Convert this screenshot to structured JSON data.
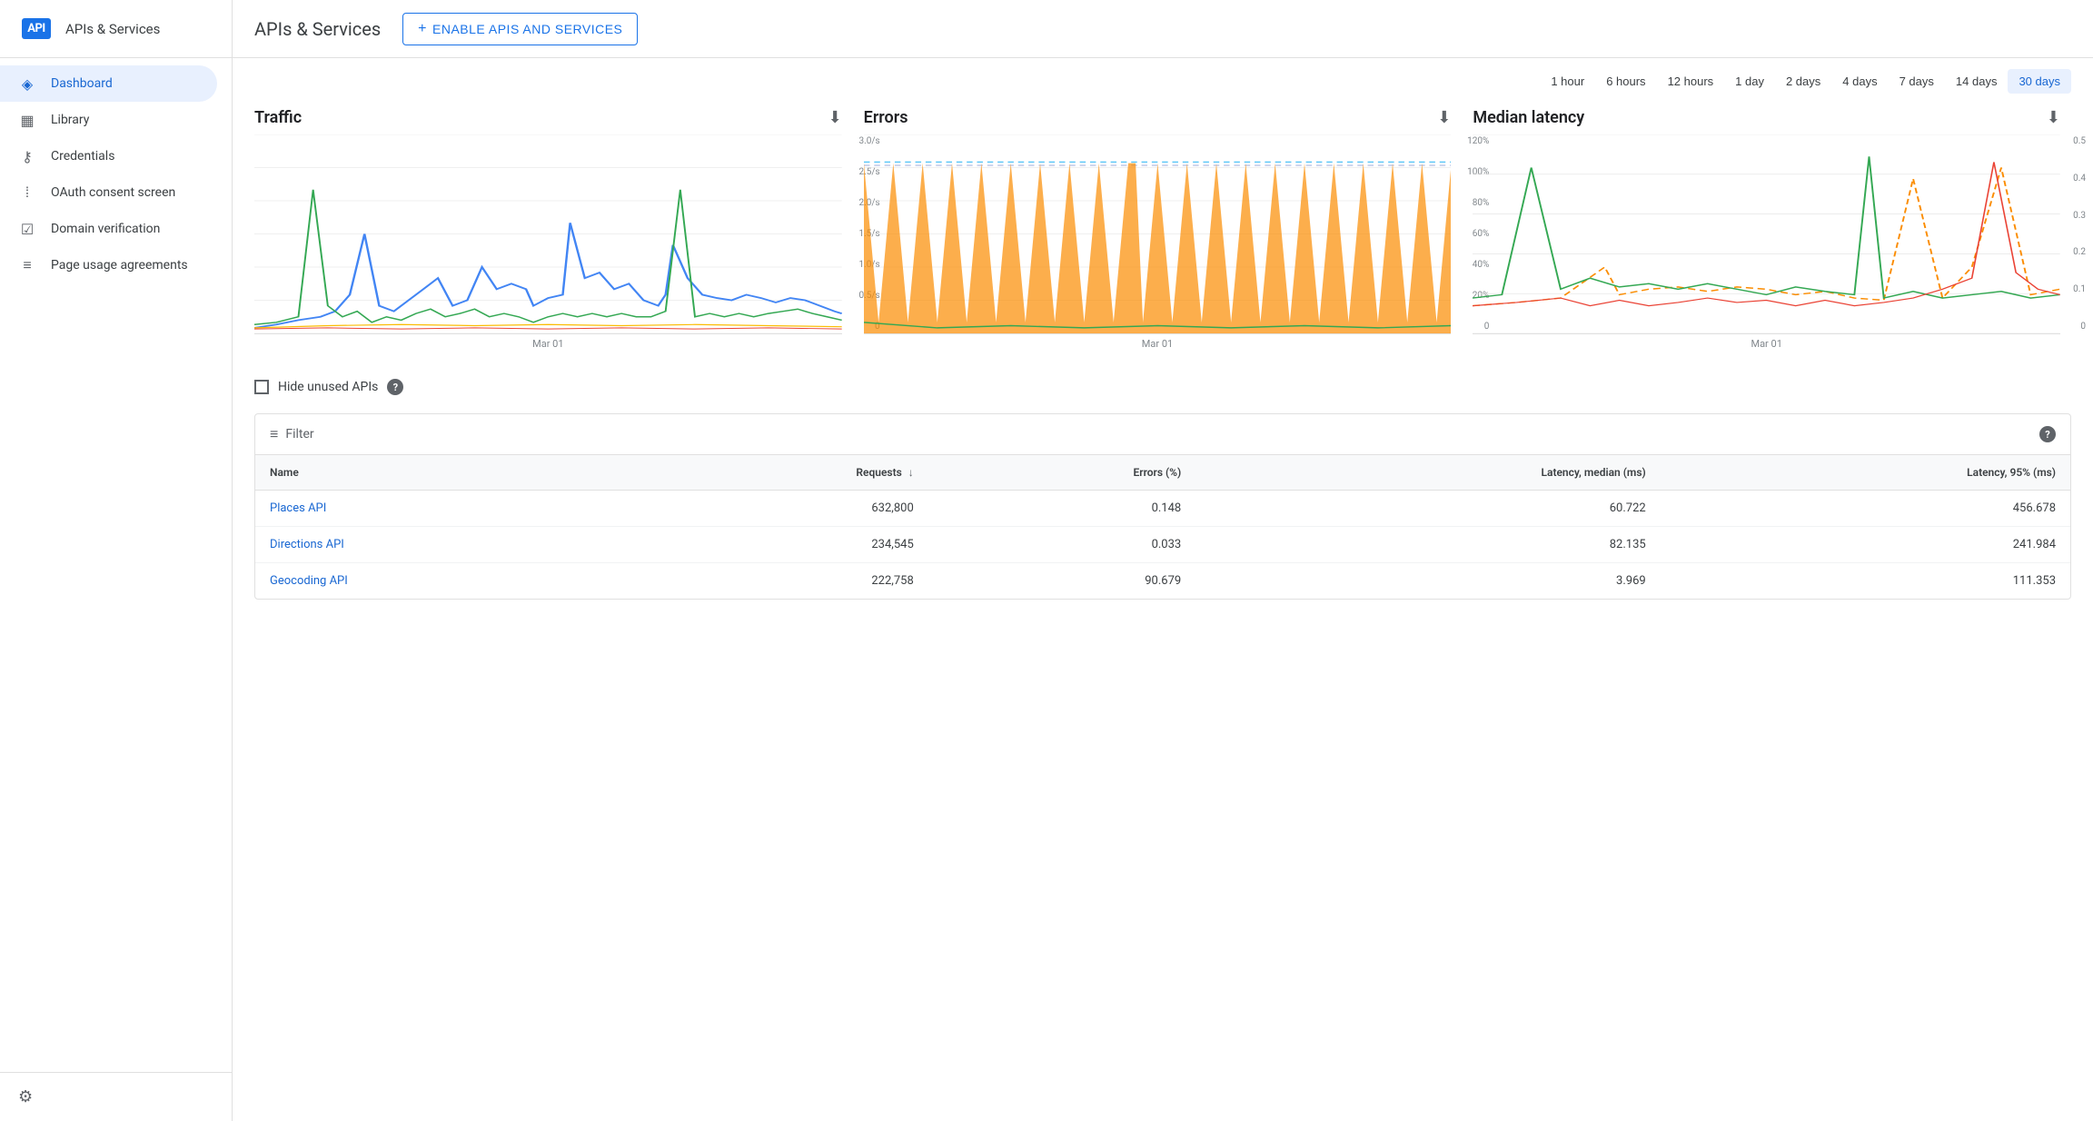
{
  "app": {
    "logo_text": "API",
    "sidebar_title": "APIs & Services",
    "main_title": "APIs & Services",
    "enable_btn_label": "ENABLE APIS AND SERVICES"
  },
  "sidebar": {
    "items": [
      {
        "id": "dashboard",
        "label": "Dashboard",
        "icon": "◈",
        "active": true
      },
      {
        "id": "library",
        "label": "Library",
        "icon": "▦",
        "active": false
      },
      {
        "id": "credentials",
        "label": "Credentials",
        "icon": "⚷",
        "active": false
      },
      {
        "id": "oauth",
        "label": "OAuth consent screen",
        "icon": "⁞",
        "active": false
      },
      {
        "id": "domain",
        "label": "Domain verification",
        "icon": "☑",
        "active": false
      },
      {
        "id": "page-usage",
        "label": "Page usage agreements",
        "icon": "≡",
        "active": false
      }
    ]
  },
  "time_range": {
    "options": [
      "1 hour",
      "6 hours",
      "12 hours",
      "1 day",
      "2 days",
      "4 days",
      "7 days",
      "14 days",
      "30 days"
    ],
    "active": "30 days"
  },
  "charts": {
    "traffic": {
      "title": "Traffic",
      "date_label": "Mar 01",
      "y_labels": [
        "3.0/s",
        "2.5/s",
        "2.0/s",
        "1.5/s",
        "1.0/s",
        "0.5/s",
        "0"
      ]
    },
    "errors": {
      "title": "Errors",
      "date_label": "Mar 01",
      "y_labels": [
        "120%",
        "100%",
        "80%",
        "60%",
        "40%",
        "20%",
        "0"
      ]
    },
    "latency": {
      "title": "Median latency",
      "date_label": "Mar 01",
      "y_labels": [
        "0.5",
        "0.4",
        "0.3",
        "0.2",
        "0.1",
        "0"
      ]
    }
  },
  "hide_unused": {
    "label": "Hide unused APIs",
    "checked": false
  },
  "filter": {
    "label": "Filter"
  },
  "table": {
    "columns": [
      "Name",
      "Requests",
      "Errors (%)",
      "Latency, median (ms)",
      "Latency, 95% (ms)"
    ],
    "rows": [
      {
        "name": "Places API",
        "requests": "632,800",
        "errors": "0.148",
        "latency_median": "60.722",
        "latency_95": "456.678"
      },
      {
        "name": "Directions API",
        "requests": "234,545",
        "errors": "0.033",
        "latency_median": "82.135",
        "latency_95": "241.984"
      },
      {
        "name": "Geocoding API",
        "requests": "222,758",
        "errors": "90.679",
        "latency_median": "3.969",
        "latency_95": "111.353"
      }
    ]
  }
}
